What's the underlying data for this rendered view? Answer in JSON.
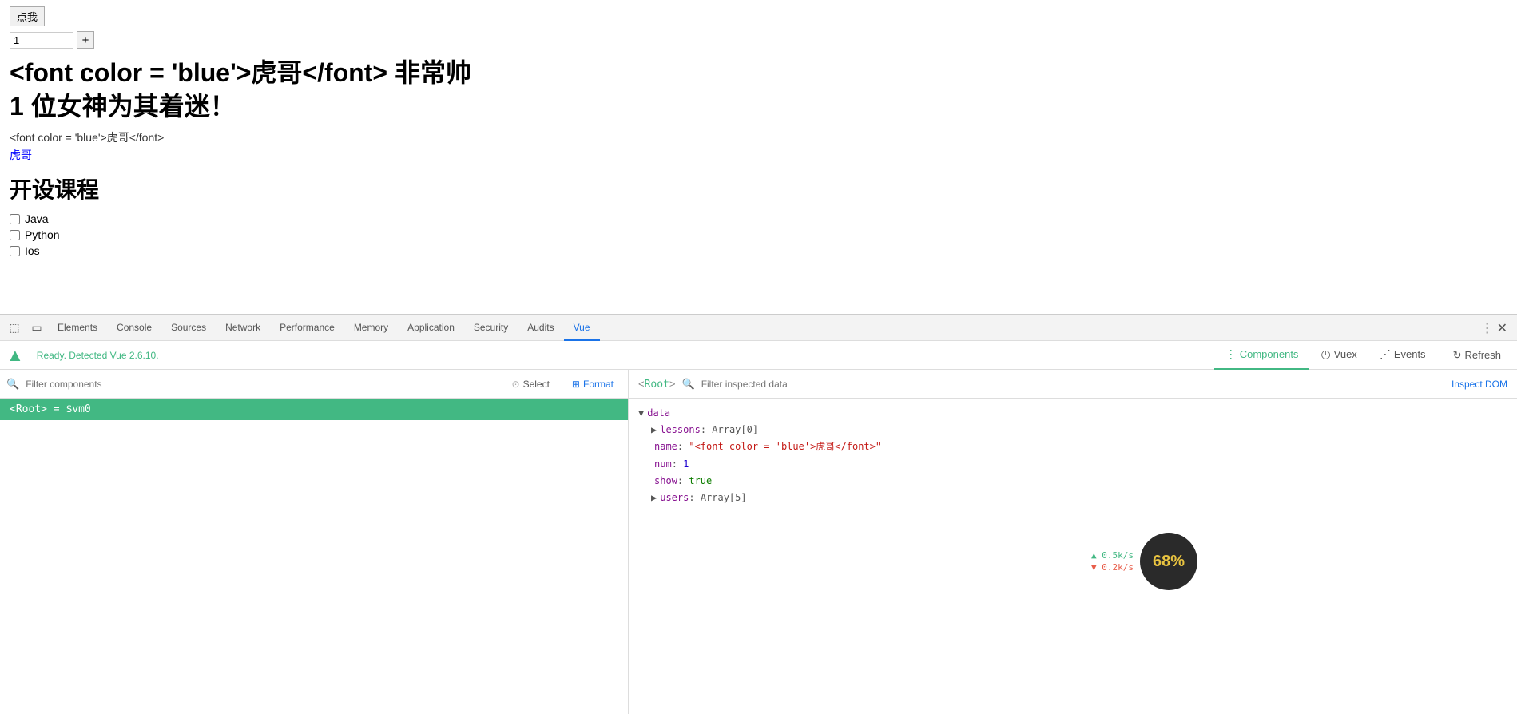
{
  "page": {
    "button_click": "点我",
    "input_value": "1",
    "plus_label": "+",
    "headline_line1": "<font color = 'blue'>虎哥</font> 非常帅",
    "headline_line2": "1 位女神为其着迷！",
    "raw_html_label": "<font color = 'blue'>虎哥</font>",
    "blue_link_text": "虎哥",
    "section_title": "开设课程",
    "courses": [
      {
        "label": "Java",
        "checked": false
      },
      {
        "label": "Python",
        "checked": false
      },
      {
        "label": "Ios",
        "checked": false
      }
    ]
  },
  "devtools": {
    "tabs": [
      {
        "label": "Elements",
        "active": false
      },
      {
        "label": "Console",
        "active": false
      },
      {
        "label": "Sources",
        "active": false
      },
      {
        "label": "Network",
        "active": false
      },
      {
        "label": "Performance",
        "active": false
      },
      {
        "label": "Memory",
        "active": false
      },
      {
        "label": "Application",
        "active": false
      },
      {
        "label": "Security",
        "active": false
      },
      {
        "label": "Audits",
        "active": false
      },
      {
        "label": "Vue",
        "active": true
      }
    ],
    "vue": {
      "status": "Ready. Detected Vue 2.6.10.",
      "nav_tabs": [
        {
          "label": "Components",
          "icon": "⋮",
          "active": true
        },
        {
          "label": "Vuex",
          "icon": "◷",
          "active": false
        },
        {
          "label": "Events",
          "icon": "⋰",
          "active": false
        }
      ],
      "refresh_label": "Refresh",
      "filter_placeholder": "Filter components",
      "select_label": "Select",
      "format_label": "Format",
      "root_component": "<Root> = $vm0",
      "data_header": {
        "root_label": "<Root>",
        "arrow": "▶",
        "filter_placeholder": "Filter inspected data",
        "inspect_dom": "Inspect DOM"
      },
      "data_tree": [
        {
          "indent": 0,
          "triangle": "▼",
          "key": "data",
          "val": "",
          "val_type": "none"
        },
        {
          "indent": 1,
          "triangle": "▶",
          "key": "lessons",
          "colon": ": ",
          "val": "Array[0]",
          "val_type": "array"
        },
        {
          "indent": 1,
          "triangle": "",
          "key": "name",
          "colon": ": ",
          "val": "\"<font color = 'blue'>虎哥</font>\"",
          "val_type": "string"
        },
        {
          "indent": 1,
          "triangle": "",
          "key": "num",
          "colon": ": ",
          "val": "1",
          "val_type": "number"
        },
        {
          "indent": 1,
          "triangle": "",
          "key": "show",
          "colon": ": ",
          "val": "true",
          "val_type": "bool"
        },
        {
          "indent": 1,
          "triangle": "▶",
          "key": "users",
          "colon": ": ",
          "val": "Array[5]",
          "val_type": "array"
        }
      ],
      "perf": {
        "percent": "68%",
        "up_stat": "▲ 0.5k/s",
        "down_stat": "▼ 0.2k/s"
      }
    }
  }
}
